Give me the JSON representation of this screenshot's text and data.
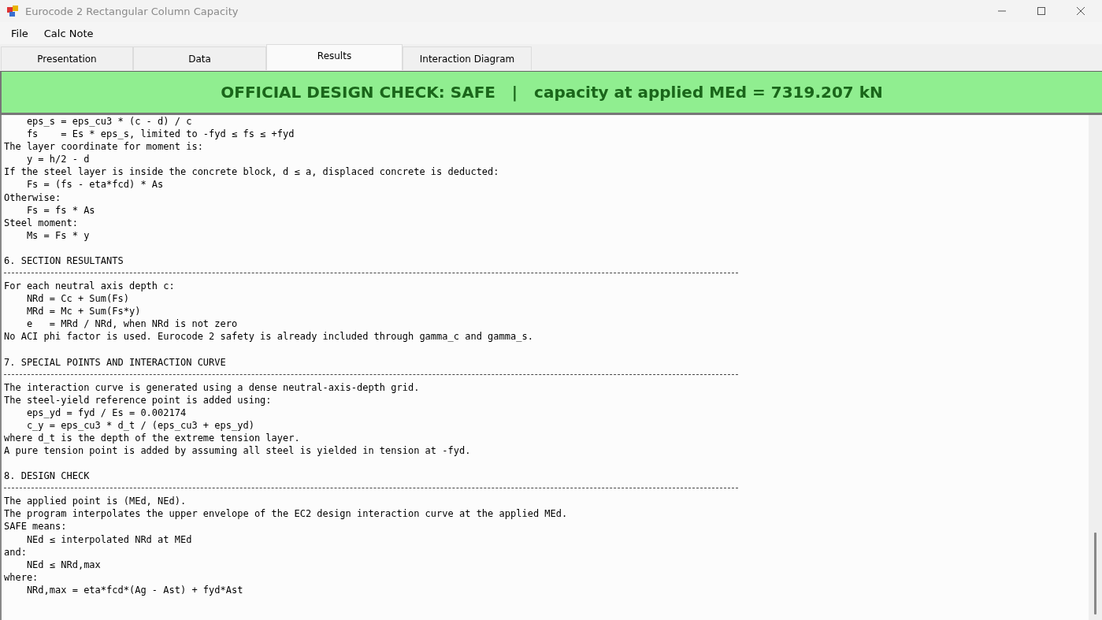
{
  "window": {
    "title": "Eurocode 2 Rectangular Column Capacity"
  },
  "menu": [
    "File",
    "Calc Note"
  ],
  "tabs": [
    {
      "label": "Presentation",
      "selected": false
    },
    {
      "label": "Data",
      "selected": false
    },
    {
      "label": "Results",
      "selected": true
    },
    {
      "label": "Interaction Diagram",
      "selected": false
    }
  ],
  "banner": {
    "safe": true,
    "text": "OFFICIAL DESIGN CHECK: SAFE   |   capacity at applied MEd = 7319.207 kN"
  },
  "report": [
    {
      "lines": [
        "    eps_s = eps_cu3 * (c - d) / c",
        "    fs    = Es * eps_s, limited to -fyd ≤ fs ≤ +fyd",
        "The layer coordinate for moment is:",
        "    y = h/2 - d",
        "If the steel layer is inside the concrete block, d ≤ a, displaced concrete is deducted:",
        "    Fs = (fs - eta*fcd) * As",
        "Otherwise:",
        "    Fs = fs * As",
        "Steel moment:",
        "    Ms = Fs * y"
      ]
    },
    {
      "heading": "6. SECTION RESULTANTS",
      "lines": [
        "For each neutral axis depth c:",
        "    NRd = Cc + Sum(Fs)",
        "    MRd = Mc + Sum(Fs*y)",
        "    e   = MRd / NRd, when NRd is not zero",
        "No ACI phi factor is used. Eurocode 2 safety is already included through gamma_c and gamma_s."
      ]
    },
    {
      "heading": "7. SPECIAL POINTS AND INTERACTION CURVE",
      "lines": [
        "The interaction curve is generated using a dense neutral-axis-depth grid.",
        "The steel-yield reference point is added using:",
        "    eps_yd = fyd / Es = 0.002174",
        "    c_y = eps_cu3 * d_t / (eps_cu3 + eps_yd)",
        "where d_t is the depth of the extreme tension layer.",
        "A pure tension point is added by assuming all steel is yielded in tension at -fyd."
      ]
    },
    {
      "heading": "8. DESIGN CHECK",
      "lines": [
        "The applied point is (MEd, NEd).",
        "The program interpolates the upper envelope of the EC2 design interaction curve at the applied MEd.",
        "SAFE means:",
        "    NEd ≤ interpolated NRd at MEd",
        "and:",
        "    NEd ≤ NRd,max",
        "where:",
        "    NRd,max = eta*fcd*(Ag - Ast) + fyd*Ast"
      ]
    }
  ]
}
